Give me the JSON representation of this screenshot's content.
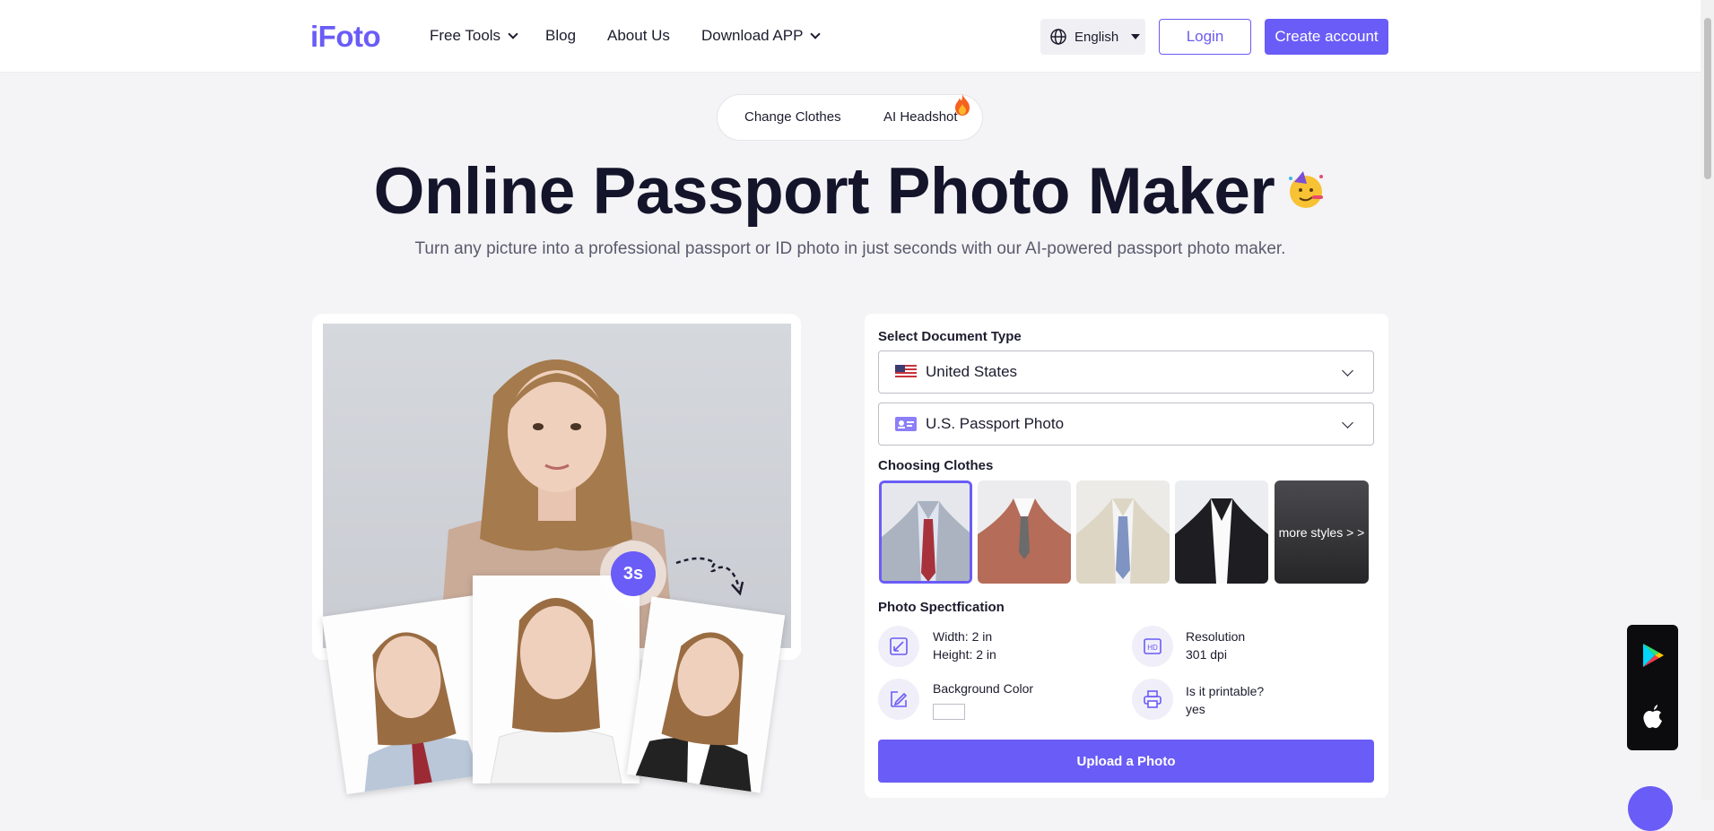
{
  "header": {
    "logo": "iFoto",
    "nav": {
      "free_tools": "Free Tools",
      "blog": "Blog",
      "about": "About Us",
      "download": "Download APP"
    },
    "language": "English",
    "login": "Login",
    "create_account": "Create account"
  },
  "tabs": {
    "change_clothes": "Change Clothes",
    "ai_headshot": "AI Headshot"
  },
  "hero": {
    "title": "Online Passport Photo Maker",
    "subtitle": "Turn any picture into a professional passport or ID photo in just seconds with our AI-powered passport photo maker."
  },
  "preview": {
    "timer": "3s"
  },
  "form": {
    "doc_type_label": "Select Document Type",
    "country": "United States",
    "doc_type": "U.S. Passport Photo",
    "clothes_label": "Choosing Clothes",
    "more_styles": "more styles > >",
    "spec_label": "Photo Spectfication",
    "width": "Width: 2 in",
    "height": "Height: 2 in",
    "resolution_label": "Resolution",
    "resolution_value": "301 dpi",
    "bg_label": "Background Color",
    "bg_color": "#ffffff",
    "printable_label": "Is it printable?",
    "printable_value": "yes",
    "upload": "Upload a Photo"
  },
  "colors": {
    "accent": "#6a5cf6"
  }
}
